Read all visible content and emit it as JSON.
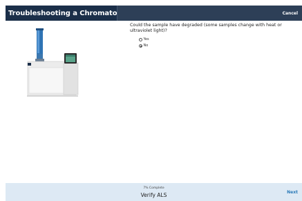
{
  "dialog": {
    "title": "Troubleshooting a Chromatographic Issue",
    "cancel_label": "Cancel"
  },
  "question": {
    "text": "Could the sample have degraded (some samples change with heat or ultraviolet light)?",
    "options": [
      {
        "label": "Yes",
        "selected": false
      },
      {
        "label": "No",
        "selected": true
      }
    ]
  },
  "footer": {
    "progress_text": "7% Complete",
    "progress_percent": 7,
    "step_name": "Verify ALS",
    "next_label": "Next"
  },
  "image": {
    "subject": "gas-chromatograph-instrument",
    "accent_color": "#2f74b5"
  },
  "colors": {
    "header_dark": "#1b2f49",
    "header_bar": "#2d3f57",
    "footer_bg": "#dde9f4",
    "link_blue": "#2a7ab8"
  }
}
